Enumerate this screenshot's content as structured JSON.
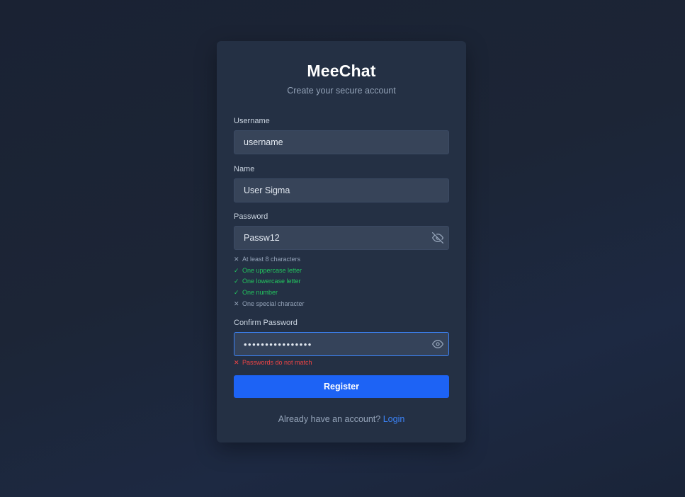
{
  "brand": {
    "title": "MeeChat",
    "subtitle": "Create your secure account"
  },
  "form": {
    "username": {
      "label": "Username",
      "value": "username"
    },
    "name": {
      "label": "Name",
      "value": "User Sigma"
    },
    "password": {
      "label": "Password",
      "value": "Passw12",
      "visibility_icon": "eye-off-icon"
    },
    "password_rules": [
      {
        "text": "At least 8 characters",
        "met": false
      },
      {
        "text": "One uppercase letter",
        "met": true
      },
      {
        "text": "One lowercase letter",
        "met": true
      },
      {
        "text": "One number",
        "met": true
      },
      {
        "text": "One special character",
        "met": false
      }
    ],
    "confirm_password": {
      "label": "Confirm Password",
      "value": "••••••••••••••••",
      "visibility_icon": "eye-icon"
    },
    "confirm_error": "Passwords do not match",
    "submit_label": "Register"
  },
  "footer": {
    "prompt": "Already have an account?",
    "link_label": "Login"
  },
  "colors": {
    "accent": "#1d63f5",
    "success": "#22c55e",
    "error": "#ef4444",
    "card": "#243044"
  },
  "symbols": {
    "check": "✓",
    "cross": "✕"
  }
}
